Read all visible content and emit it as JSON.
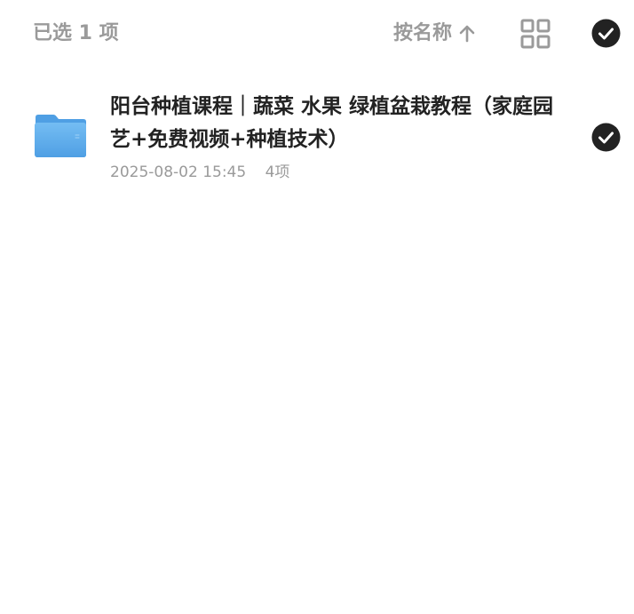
{
  "header": {
    "selected_count": "已选 1 项",
    "sort_label": "按名称",
    "sort_direction_icon": "arrow-up-icon",
    "view_toggle_icon": "grid-view-icon",
    "select_all_icon": "check-circle-icon"
  },
  "files": [
    {
      "name": "阳台种植课程｜蔬菜 水果 绿植盆栽教程（家庭园艺+免费视频+种植技术）",
      "date": "2025-08-02 15:45",
      "count": "4项",
      "icon": "folder-icon",
      "selected": true
    }
  ],
  "colors": {
    "muted_text": "#9a9a9a",
    "primary_text": "#222222",
    "check_fill": "#222222",
    "folder_blue": "#5aa9ea"
  }
}
